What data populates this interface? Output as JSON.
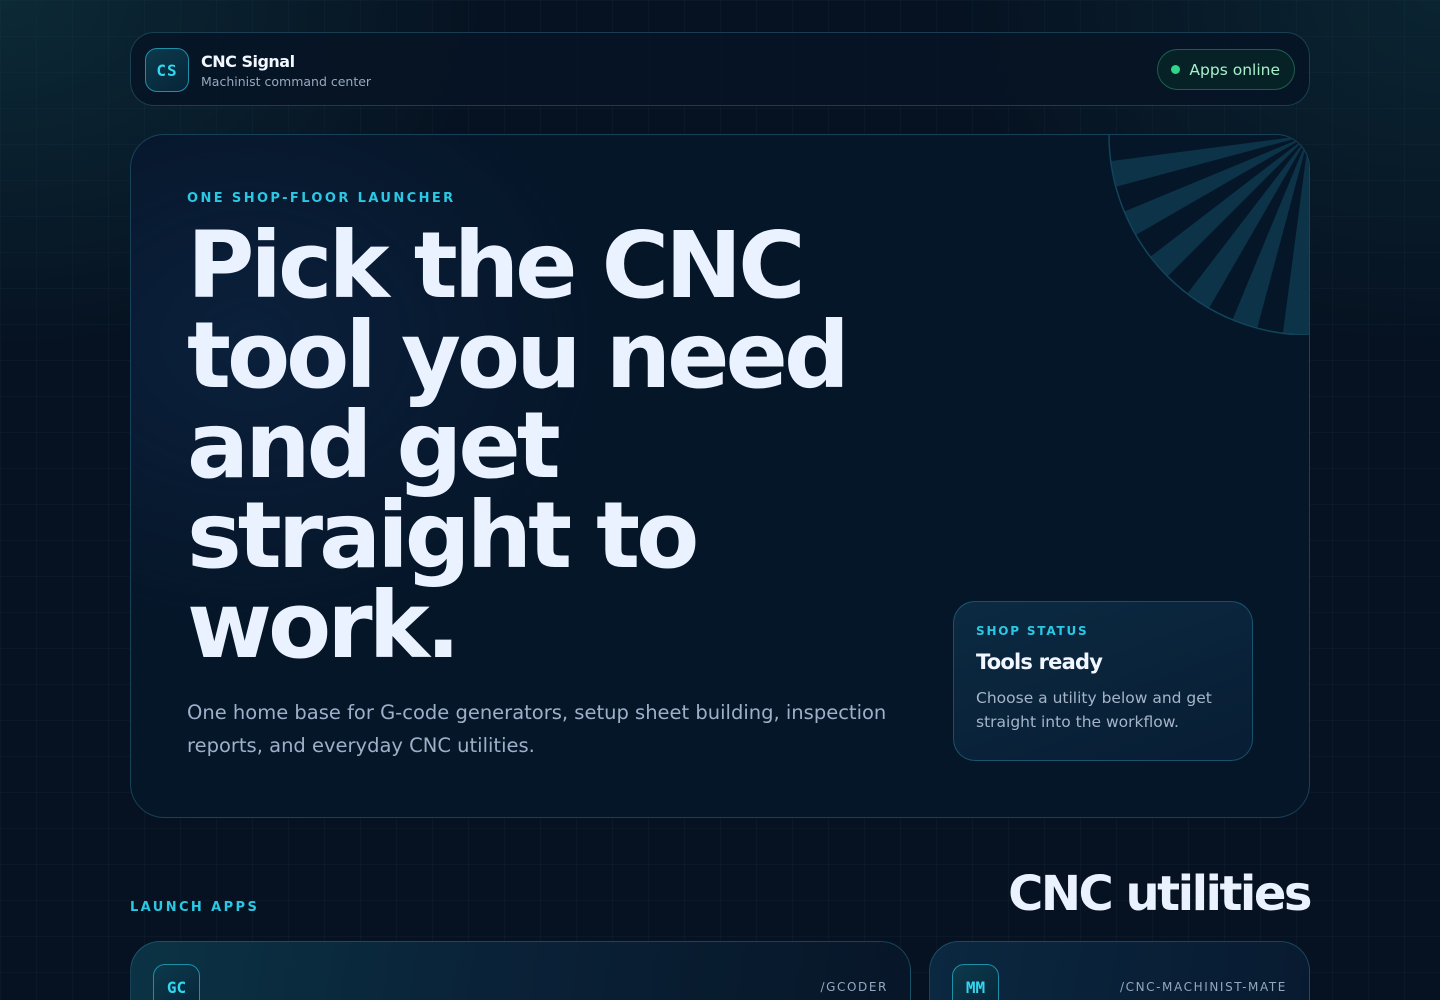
{
  "header": {
    "logo_text": "CS",
    "title": "CNC Signal",
    "subtitle": "Machinist command center",
    "status_label": "Apps online",
    "status_color": "#2fd68a"
  },
  "hero": {
    "eyebrow": "ONE SHOP-FLOOR LAUNCHER",
    "title": "Pick the CNC tool you need and get straight to work.",
    "description": "One home base for G-code generators, setup sheet building, inspection reports, and everyday CNC utilities.",
    "status_card": {
      "eyebrow": "SHOP STATUS",
      "title": "Tools ready",
      "description": "Choose a utility below and get straight into the workflow."
    }
  },
  "apps_section": {
    "eyebrow": "LAUNCH APPS",
    "title": "CNC utilities",
    "apps": [
      {
        "badge": "GC",
        "route": "/GCODER"
      },
      {
        "badge": "MM",
        "route": "/CNC-MACHINIST-MATE"
      }
    ]
  },
  "colors": {
    "accent": "#2bc8e4",
    "background": "#061221",
    "text": "#eaf2ff"
  }
}
